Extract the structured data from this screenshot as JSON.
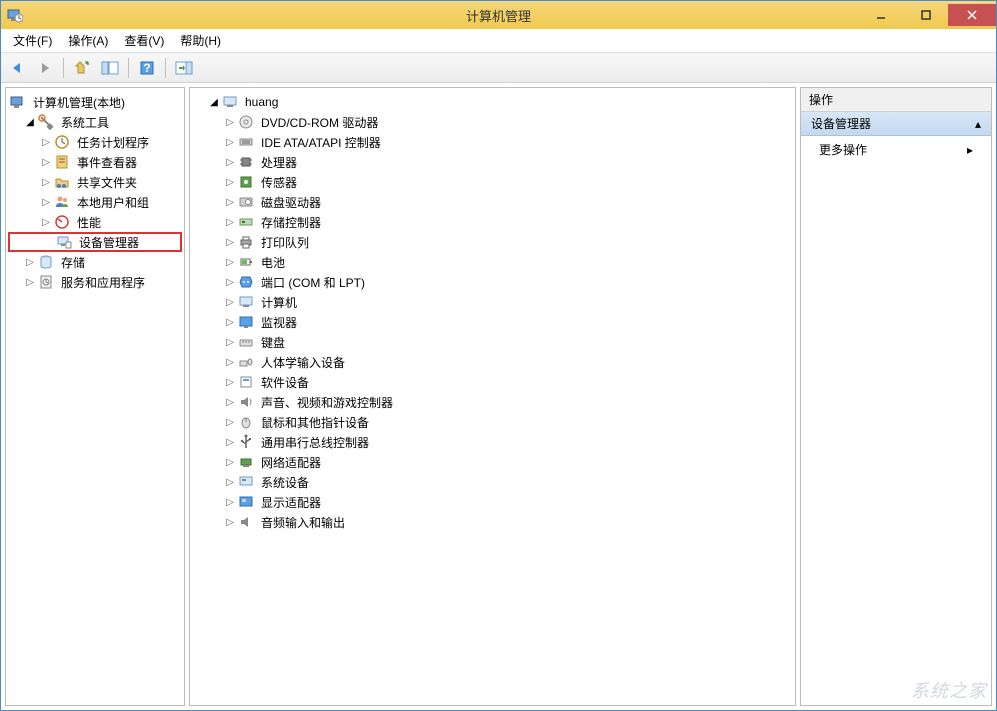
{
  "window": {
    "title": "计算机管理"
  },
  "menu": {
    "file": "文件(F)",
    "action": "操作(A)",
    "view": "查看(V)",
    "help": "帮助(H)"
  },
  "leftTree": {
    "root": "计算机管理(本地)",
    "systemTools": "系统工具",
    "taskScheduler": "任务计划程序",
    "eventViewer": "事件查看器",
    "sharedFolders": "共享文件夹",
    "localUsers": "本地用户和组",
    "performance": "性能",
    "deviceManager": "设备管理器",
    "storage": "存储",
    "services": "服务和应用程序"
  },
  "midTree": {
    "computer": "huang",
    "dvdcd": "DVD/CD-ROM 驱动器",
    "ide": "IDE ATA/ATAPI 控制器",
    "cpu": "处理器",
    "sensor": "传感器",
    "disk": "磁盘驱动器",
    "storageCtrl": "存储控制器",
    "printQueue": "打印队列",
    "battery": "电池",
    "ports": "端口 (COM 和 LPT)",
    "computers": "计算机",
    "monitor": "监视器",
    "keyboard": "键盘",
    "hid": "人体学输入设备",
    "software": "软件设备",
    "sound": "声音、视频和游戏控制器",
    "mouse": "鼠标和其他指针设备",
    "usb": "通用串行总线控制器",
    "network": "网络适配器",
    "systemDev": "系统设备",
    "display": "显示适配器",
    "audio": "音频输入和输出"
  },
  "actions": {
    "header": "操作",
    "section": "设备管理器",
    "more": "更多操作"
  },
  "watermark": "系统之家"
}
